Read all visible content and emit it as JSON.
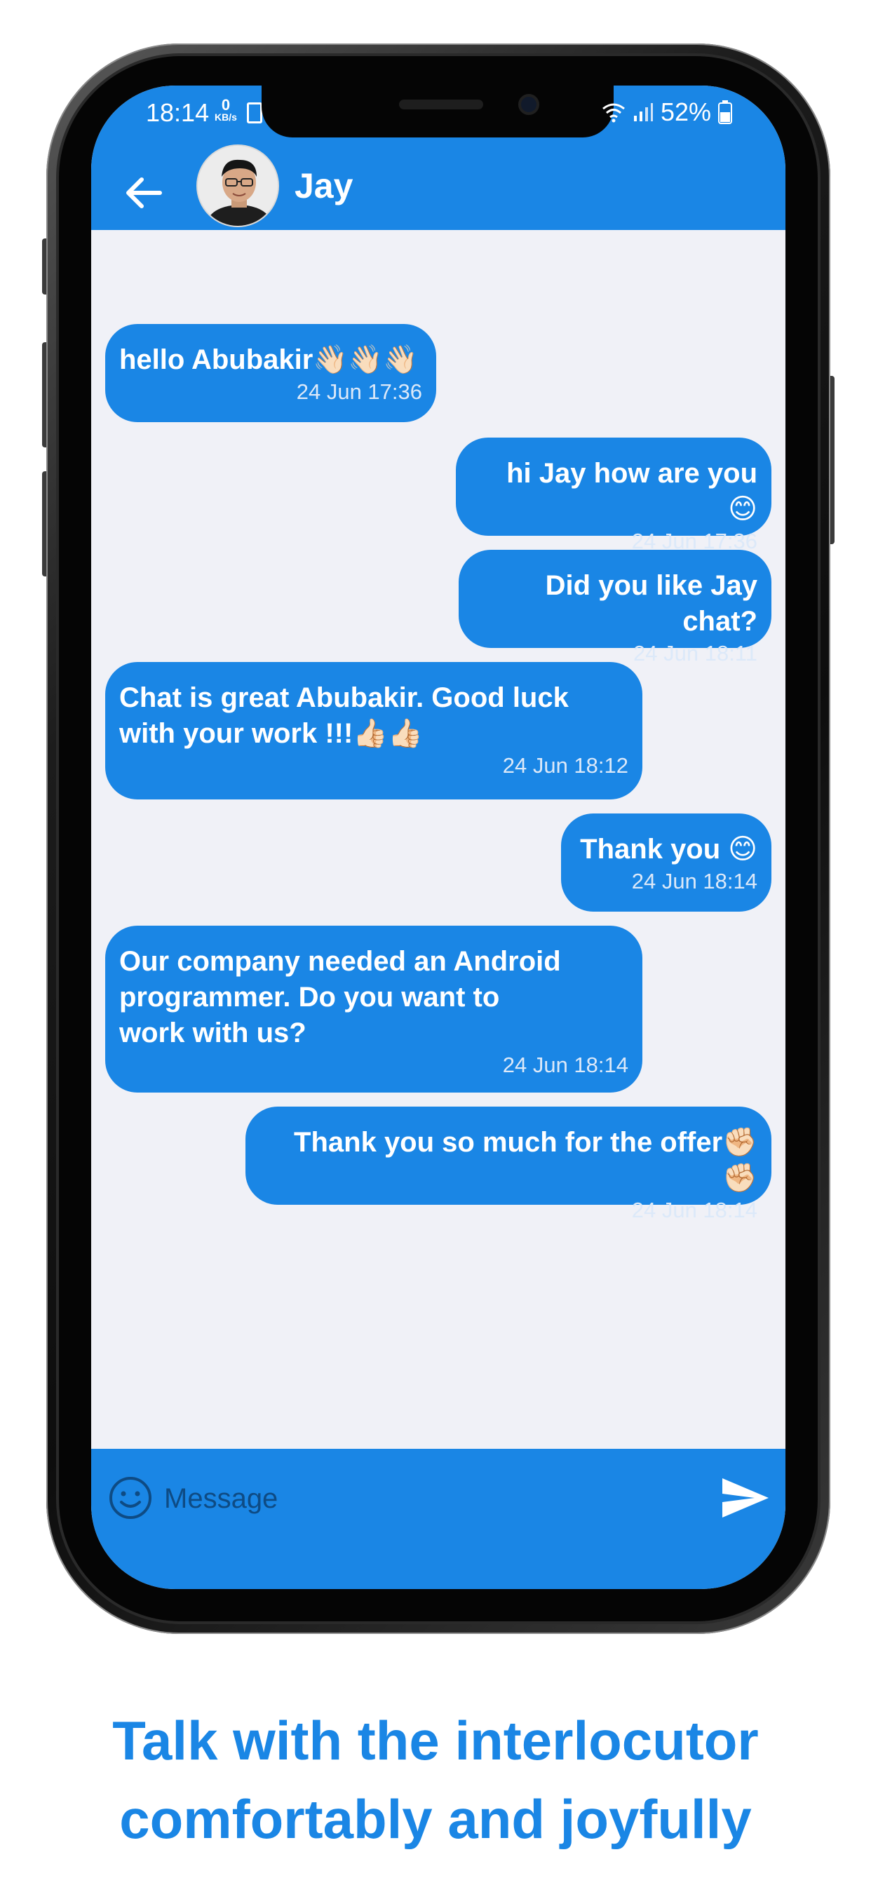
{
  "status_bar": {
    "time": "18:14",
    "net_speed_value": "0",
    "net_speed_unit": "KB/s",
    "battery": "52%"
  },
  "chat": {
    "contact_name": "Jay",
    "icons": {
      "back": "back-arrow-icon",
      "avatar": "avatar",
      "emoji": "emoji-icon",
      "send": "send-icon"
    },
    "messages": [
      {
        "side": "left",
        "text": "hello Abubakir👋🏻👋🏻👋🏻",
        "time": "24 Jun 17:36"
      },
      {
        "side": "right",
        "text": "hi Jay how are you 😊",
        "time": "24 Jun 17:36"
      },
      {
        "side": "right",
        "text": "Did you like Jay chat?",
        "time": "24 Jun 18:11"
      },
      {
        "side": "left",
        "text": "Chat is great Abubakir. Good luck with your work !!!👍🏻👍🏻",
        "time": "24 Jun 18:12"
      },
      {
        "side": "right",
        "text": "Thank you 😊",
        "time": "24 Jun 18:14"
      },
      {
        "side": "left",
        "text": "Our company needed an Android programmer. Do you want to work with us?",
        "time": "24 Jun 18:14"
      },
      {
        "side": "right",
        "text": "Thank you so much for the offer✊🏻✊🏻",
        "time": "24 Jun 18:14"
      }
    ],
    "input_placeholder": "Message"
  },
  "caption": {
    "line1": "Talk with the interlocutor",
    "line2": "comfortably and joyfully"
  },
  "colors": {
    "accent": "#1a86e5",
    "chat_background": "#f0f1f7",
    "timestamp": "#dce9f9"
  }
}
